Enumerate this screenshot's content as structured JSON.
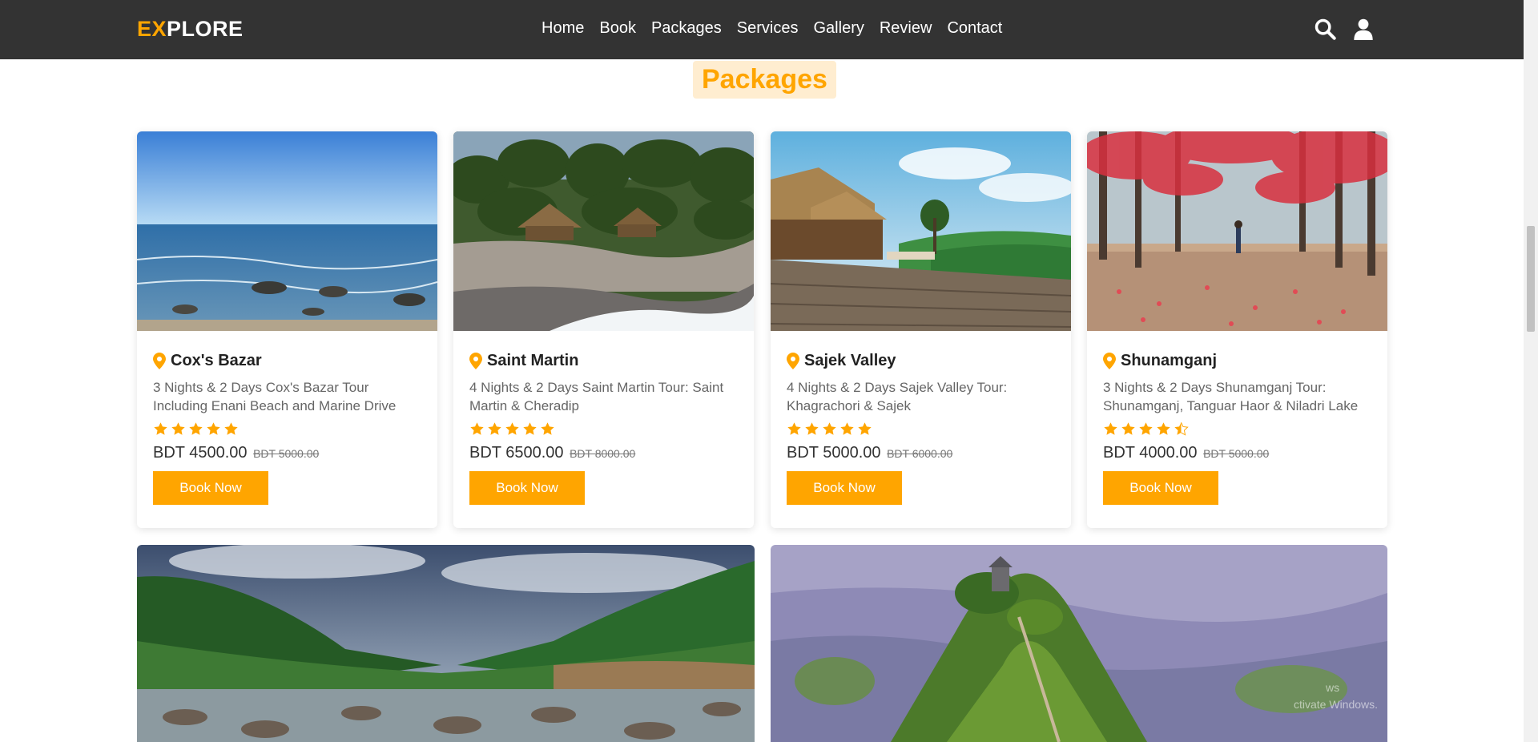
{
  "header": {
    "logo_accent": "EX",
    "logo_rest": "PLORE",
    "nav": [
      "Home",
      "Book",
      "Packages",
      "Services",
      "Gallery",
      "Review",
      "Contact"
    ],
    "icons": [
      "search-icon",
      "user-icon"
    ]
  },
  "section": {
    "title": "Packages"
  },
  "cards": [
    {
      "location": "Cox's Bazar",
      "description": "3 Nights & 2 Days Cox's Bazar Tour Including Enani Beach and Marine Drive",
      "rating": 5,
      "price": "BDT 4500.00",
      "old_price": "BDT 5000.00",
      "button": "Book Now"
    },
    {
      "location": "Saint Martin",
      "description": "4 Nights & 2 Days Saint Martin Tour: Saint Martin & Cheradip",
      "rating": 5,
      "price": "BDT 6500.00",
      "old_price": "BDT 8000.00",
      "button": "Book Now"
    },
    {
      "location": "Sajek Valley",
      "description": "4 Nights & 2 Days Sajek Valley Tour: Khagrachori & Sajek",
      "rating": 5,
      "price": "BDT 5000.00",
      "old_price": "BDT 6000.00",
      "button": "Book Now"
    },
    {
      "location": "Shunamganj",
      "description": "3 Nights & 2 Days Shunamganj Tour: Shunamganj, Tanguar Haor & Niladri Lake",
      "rating": 4.5,
      "price": "BDT 4000.00",
      "old_price": "BDT 5000.00",
      "button": "Book Now"
    }
  ],
  "watermark": {
    "line1": "ws",
    "line2": "ctivate Windows."
  },
  "colors": {
    "accent": "#ffa500",
    "header_bg": "#333333",
    "title_bg": "#ffedd0"
  }
}
